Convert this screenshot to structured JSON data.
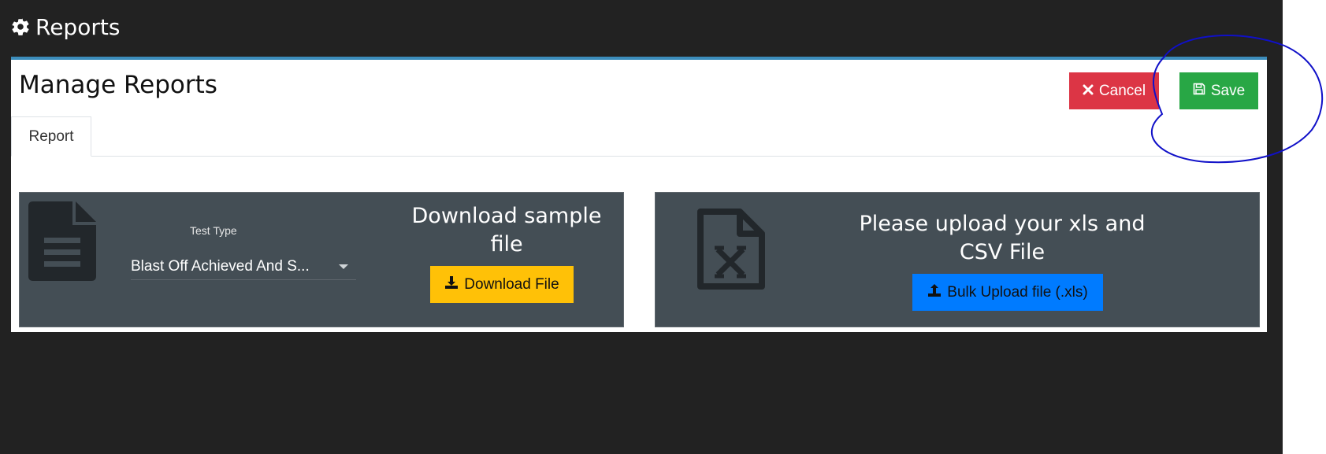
{
  "header": {
    "title": "Reports",
    "icon": "gear-icon"
  },
  "card": {
    "title": "Manage Reports",
    "cancel_label": "Cancel",
    "save_label": "Save"
  },
  "tabs": [
    {
      "label": "Report",
      "active": true
    }
  ],
  "download_panel": {
    "field_label": "Test Type",
    "selected_value": "Blast Off Achieved And S...",
    "heading": "Download sample file",
    "button_label": "Download File"
  },
  "upload_panel": {
    "heading": "Please upload your xls and CSV File",
    "button_label": "Bulk Upload file (.xls)"
  },
  "colors": {
    "background": "#222222",
    "card_accent": "#3c8dbc",
    "cancel": "#dc3545",
    "save": "#28a745",
    "download": "#ffc107",
    "upload": "#007bff",
    "panel": "#444e55",
    "annotation": "#1010c8"
  }
}
